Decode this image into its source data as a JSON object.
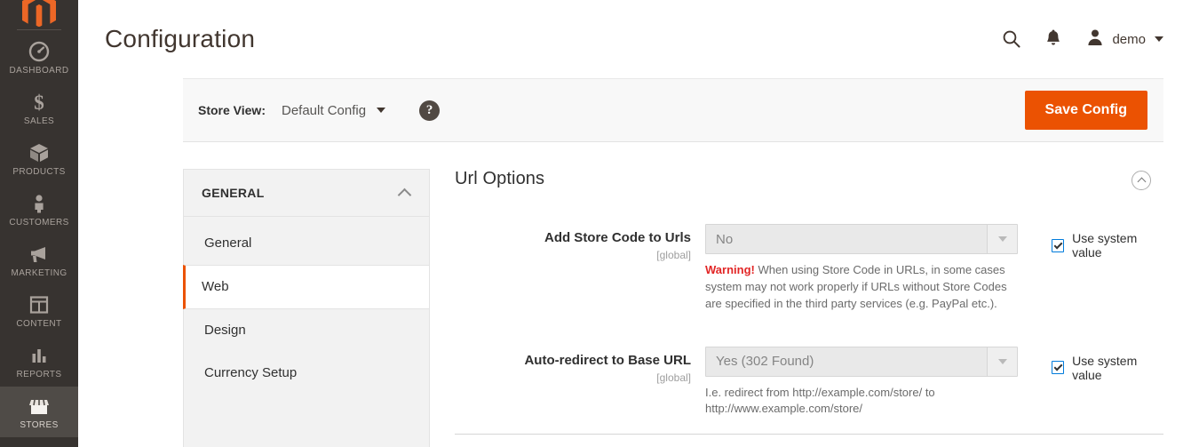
{
  "sidebar": {
    "logo_icon": "magento-logo-icon",
    "items": [
      {
        "label": "DASHBOARD",
        "icon": "dashboard-gauge-icon",
        "active": false
      },
      {
        "label": "SALES",
        "icon": "dollar-sign-icon",
        "active": false
      },
      {
        "label": "PRODUCTS",
        "icon": "box-icon",
        "active": false
      },
      {
        "label": "CUSTOMERS",
        "icon": "person-icon",
        "active": false
      },
      {
        "label": "MARKETING",
        "icon": "megaphone-icon",
        "active": false
      },
      {
        "label": "CONTENT",
        "icon": "layout-grid-icon",
        "active": false
      },
      {
        "label": "REPORTS",
        "icon": "bar-chart-icon",
        "active": false
      },
      {
        "label": "STORES",
        "icon": "storefront-awning-icon",
        "active": true
      }
    ]
  },
  "header": {
    "title": "Configuration",
    "search_icon": "search-icon",
    "notifications_icon": "bell-icon",
    "avatar_icon": "user-avatar-icon",
    "user_name": "demo",
    "user_caret_icon": "chevron-down-icon"
  },
  "store_bar": {
    "label": "Store View:",
    "selected_scope": "Default Config",
    "scope_caret_icon": "chevron-down-icon",
    "help_icon": "question-mark-help-icon",
    "help_glyph": "?",
    "save_label": "Save Config"
  },
  "config_nav": {
    "group_title": "GENERAL",
    "collapse_icon": "chevron-up-icon",
    "items": [
      {
        "label": "General",
        "current": false
      },
      {
        "label": "Web",
        "current": true
      },
      {
        "label": "Design",
        "current": false
      },
      {
        "label": "Currency Setup",
        "current": false
      }
    ]
  },
  "section": {
    "title": "Url Options",
    "collapse_icon": "chevron-up-circle-icon",
    "fields": [
      {
        "label": "Add Store Code to Urls",
        "scope": "[global]",
        "value": "No",
        "dropdown_icon": "triangle-down-icon",
        "note_strong": "Warning!",
        "note": " When using Store Code in URLs, in some cases system may not work properly if URLs without Store Codes are specified in the third party services (e.g. PayPal etc.).",
        "checkbox_label": "Use system value",
        "checkbox_checked": true
      },
      {
        "label": "Auto-redirect to Base URL",
        "scope": "[global]",
        "value": "Yes (302 Found)",
        "dropdown_icon": "triangle-down-icon",
        "note_strong": "",
        "note": "I.e. redirect from http://example.com/store/ to http://www.example.com/store/",
        "checkbox_label": "Use system value",
        "checkbox_checked": true
      }
    ]
  },
  "colors": {
    "brand_orange": "#eb5202",
    "sidebar_bg": "#373330",
    "warning_red": "#e22626",
    "checkbox_blue": "#007bdb"
  }
}
